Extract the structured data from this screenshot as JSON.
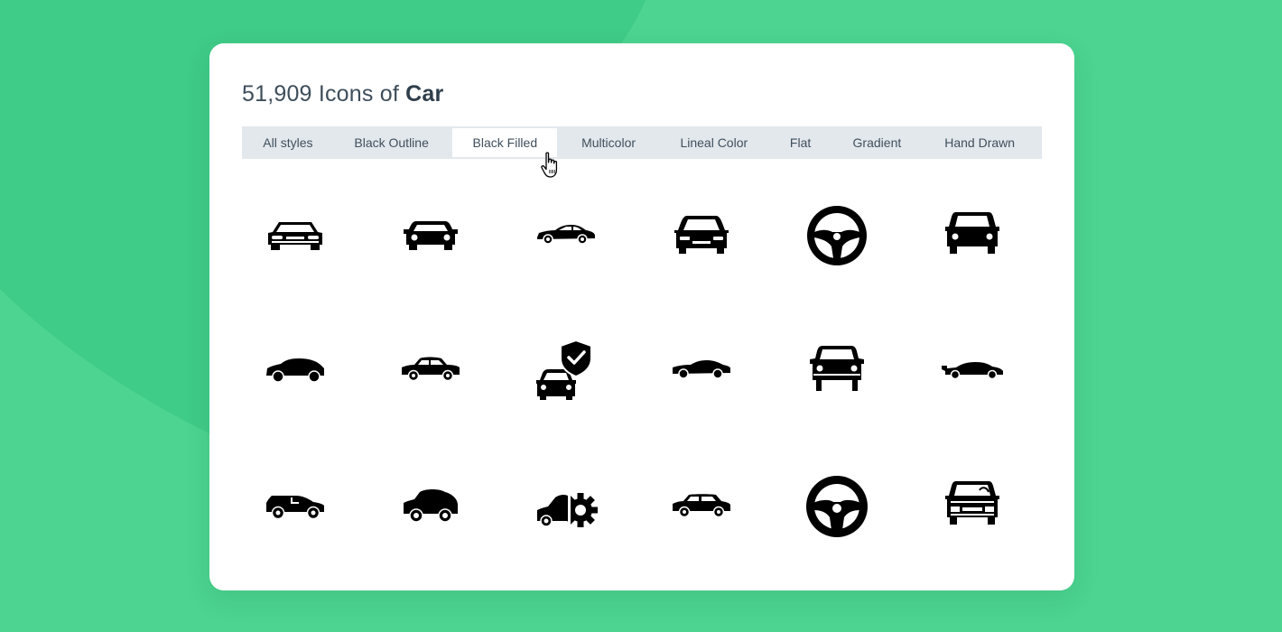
{
  "header": {
    "count": "51,909",
    "title_middle": " Icons of ",
    "keyword": "Car"
  },
  "tabs": [
    {
      "label": "All styles"
    },
    {
      "label": "Black Outline"
    },
    {
      "label": "Black Filled"
    },
    {
      "label": "Multicolor"
    },
    {
      "label": "Lineal Color"
    },
    {
      "label": "Flat"
    },
    {
      "label": "Gradient"
    },
    {
      "label": "Hand Drawn"
    }
  ],
  "active_tab": "Black Filled",
  "icons": [
    "car-front-outline-icon",
    "car-front-icon",
    "sedan-side-icon",
    "car-front-solid-icon",
    "steering-wheel-icon",
    "car-front-boxy-icon",
    "hatchback-side-icon",
    "sedan-small-side-icon",
    "car-insurance-shield-icon",
    "sports-sedan-side-icon",
    "car-front-round-icon",
    "sports-car-spoiler-icon",
    "suv-side-icon",
    "compact-car-side-icon",
    "car-settings-gear-icon",
    "mini-car-side-icon",
    "steering-wheel-large-icon",
    "vintage-car-front-icon"
  ],
  "colors": {
    "background": "#4cd490",
    "card": "#ffffff",
    "tab_bar": "#e3e8ed",
    "text": "#3d4e5b",
    "icon": "#000000"
  }
}
